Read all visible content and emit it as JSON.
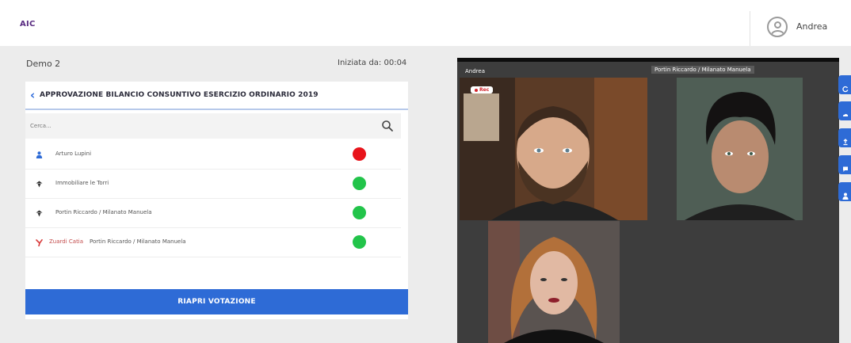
{
  "header": {
    "logo": "AIC",
    "user_name": "Andrea"
  },
  "meeting": {
    "name": "Demo 2",
    "started_label": "Iniziata da: 00:04"
  },
  "panel": {
    "title": "APPROVAZIONE BILANCIO CONSUNTIVO ESERCIZIO ORDINARIO 2019",
    "search_placeholder": "Cerca...",
    "rows": [
      {
        "icon": "person-icon",
        "alt_name": "",
        "label": "Arturo Lupini",
        "status_color": "#e8141b"
      },
      {
        "icon": "building-icon",
        "alt_name": "",
        "label": "Immobiliare le Torri",
        "status_color": "#22c44a"
      },
      {
        "icon": "building-icon",
        "alt_name": "",
        "label": "Portin Riccardo / Milanato Manuela",
        "status_color": "#22c44a"
      },
      {
        "icon": "delegate-icon",
        "alt_name": "Zuardi Catia",
        "label": "Portin Riccardo / Milanato Manuela",
        "status_color": "#22c44a"
      }
    ],
    "reopen_button": "RIAPRI VOTAZIONE"
  },
  "video": {
    "tile_1_name": "Andrea",
    "tile_2_name": "Portin Riccardo / Milanato Manuela",
    "rec_label": "Rec"
  },
  "side_buttons": [
    "refresh-icon",
    "cloud-icon",
    "upload-icon",
    "chat-icon",
    "user-icon"
  ],
  "colors": {
    "accent": "#2e6bd6",
    "logo": "#5a2d82",
    "vote_no": "#e8141b",
    "vote_yes": "#22c44a"
  }
}
